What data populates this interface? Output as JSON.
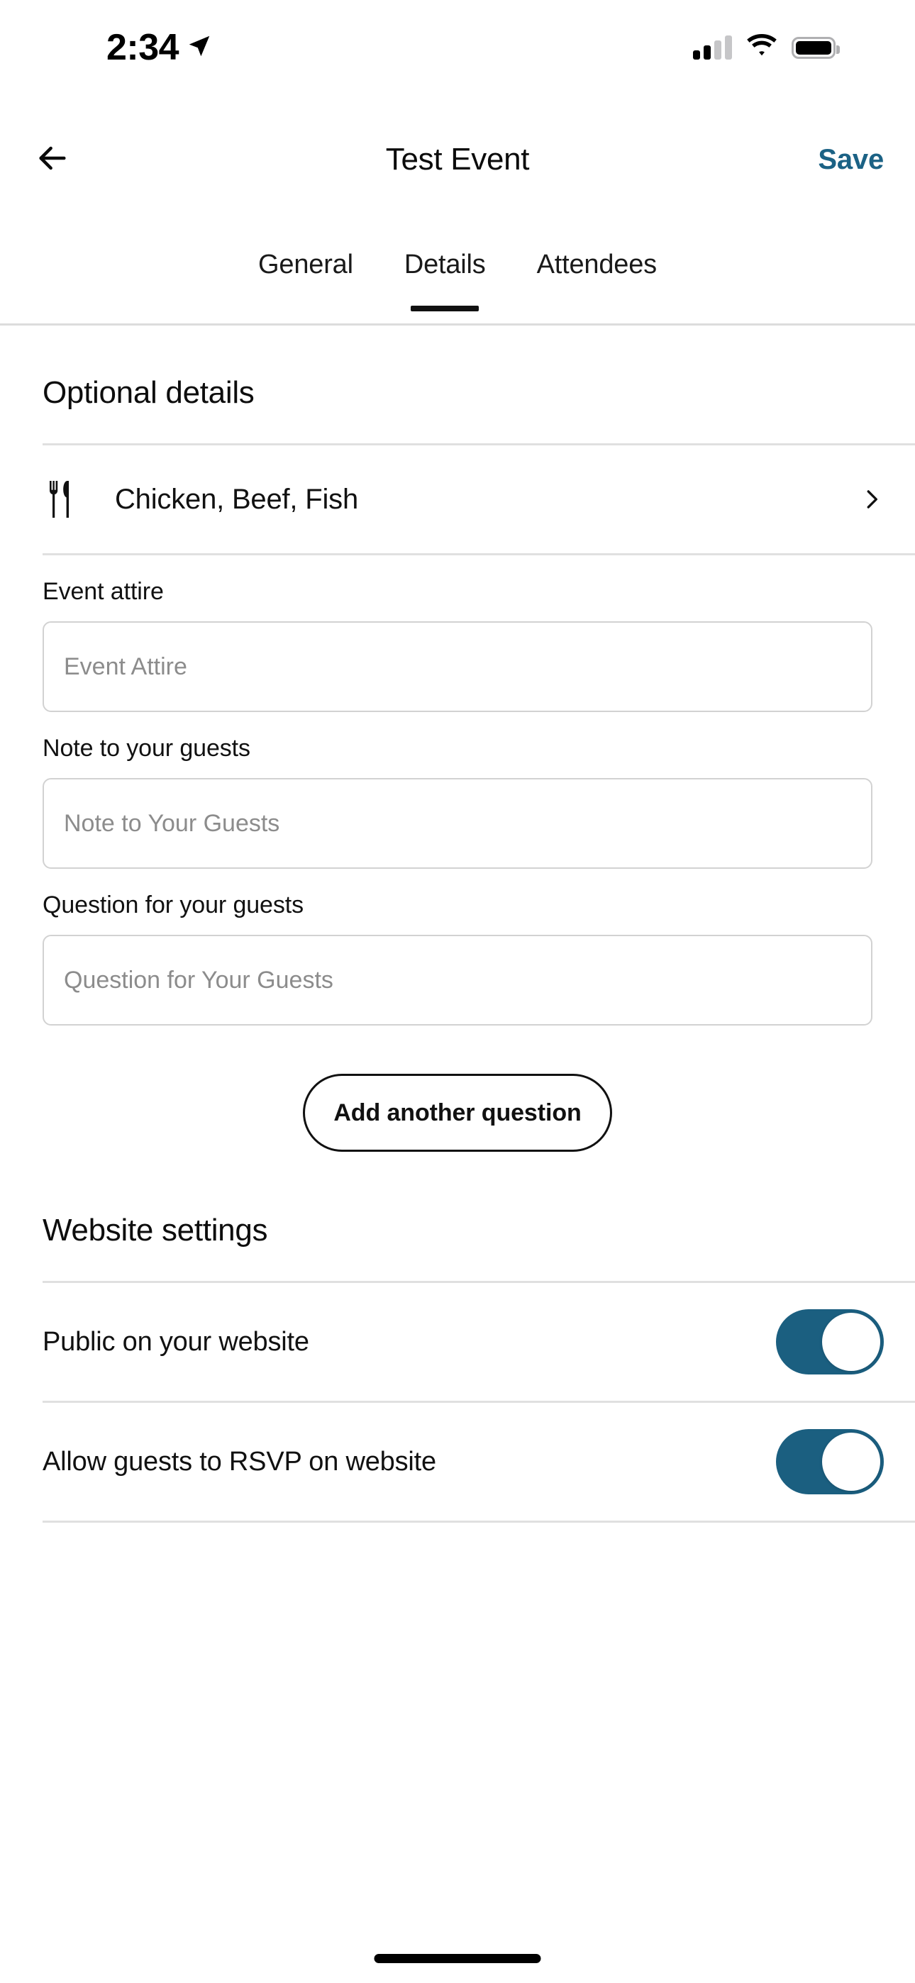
{
  "status_bar": {
    "time": "2:34",
    "location_icon": "location-arrow-icon",
    "cellular_icon": "cellular-signal-icon",
    "wifi_icon": "wifi-icon",
    "battery_icon": "battery-icon"
  },
  "nav": {
    "back_icon": "back-arrow-icon",
    "title": "Test Event",
    "save_label": "Save"
  },
  "tabs": [
    {
      "label": "General",
      "active": false
    },
    {
      "label": "Details",
      "active": true
    },
    {
      "label": "Attendees",
      "active": false
    }
  ],
  "optional_details": {
    "section_title": "Optional details",
    "meal_row": {
      "icon": "fork-knife-icon",
      "value": "Chicken, Beef, Fish",
      "chevron": "chevron-right-icon"
    },
    "fields": [
      {
        "label": "Event attire",
        "placeholder": "Event Attire",
        "value": ""
      },
      {
        "label": "Note to your guests",
        "placeholder": "Note to Your Guests",
        "value": ""
      },
      {
        "label": "Question for your guests",
        "placeholder": "Question for Your Guests",
        "value": ""
      }
    ],
    "add_question_label": "Add another question"
  },
  "website_settings": {
    "section_title": "Website settings",
    "toggles": [
      {
        "label": "Public on your website",
        "on": true
      },
      {
        "label": "Allow guests to RSVP on website",
        "on": true
      }
    ]
  },
  "colors": {
    "accent": "#1b6285",
    "toggle_on": "#1b5f80",
    "divider": "#e0e0e0",
    "placeholder": "#8c8c8c",
    "text": "#111111"
  }
}
